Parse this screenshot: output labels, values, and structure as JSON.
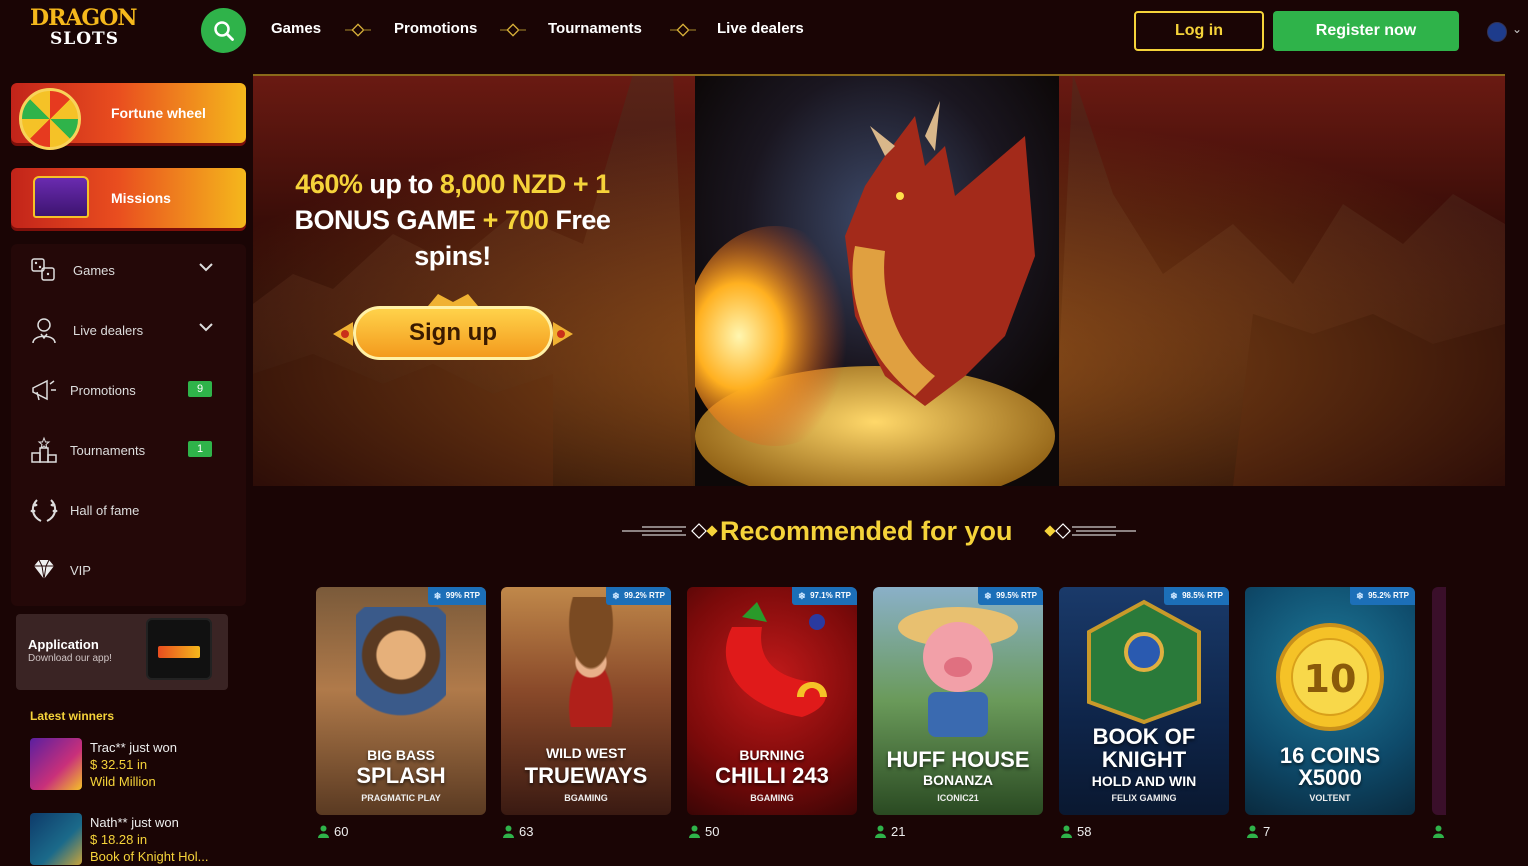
{
  "header": {
    "logo_line1": "DRAGON",
    "logo_line2": "SLOTS",
    "nav": [
      "Games",
      "Promotions",
      "Tournaments",
      "Live dealers"
    ],
    "login_label": "Log in",
    "register_label": "Register now",
    "language_icon": "nz-flag-icon"
  },
  "sidebar": {
    "fortune_wheel": "Fortune wheel",
    "missions": "Missions",
    "menu": [
      {
        "label": "Games",
        "icon": "games-icon",
        "expandable": true
      },
      {
        "label": "Live dealers",
        "icon": "dealer-icon",
        "expandable": true
      },
      {
        "label": "Promotions",
        "icon": "megaphone-icon",
        "badge": "9"
      },
      {
        "label": "Tournaments",
        "icon": "podium-icon",
        "badge": "1"
      },
      {
        "label": "Hall of fame",
        "icon": "laurel-icon"
      },
      {
        "label": "VIP",
        "icon": "diamond-icon"
      }
    ],
    "app": {
      "title": "Application",
      "subtitle": "Download our app!"
    },
    "winners_title": "Latest winners",
    "winners": [
      {
        "user": "Trac** just won",
        "amount": "$ 32.51 in",
        "game": "Wild Million"
      },
      {
        "user": "Nath** just won",
        "amount": "$ 18.28 in",
        "game": "Book of Knight Hol..."
      }
    ]
  },
  "hero": {
    "line1_a": "460%",
    "line1_b": " up to ",
    "line1_c": "8,000 NZD",
    "line1_d": " + 1",
    "line2_a": "BONUS GAME ",
    "line2_b": "+ 700",
    "line2_c": " Free",
    "line3": "spins!",
    "cta": "Sign up"
  },
  "recommended": {
    "title": "Recommended for you",
    "games": [
      {
        "top": "BIG BASS",
        "main": "SPLASH",
        "provider": "PRAGMATIC PLAY",
        "rtp": "99% RTP",
        "players": "60"
      },
      {
        "top": "WILD WEST",
        "main": "TRUEWAYS",
        "provider": "BGAMING",
        "rtp": "99.2% RTP",
        "players": "63"
      },
      {
        "top": "BURNING",
        "main": "CHILLI 243",
        "provider": "BGAMING",
        "rtp": "97.1% RTP",
        "players": "50"
      },
      {
        "top": "HUFF HOUSE",
        "main": "BONANZA",
        "provider": "ICONIC21",
        "rtp": "99.5% RTP",
        "players": "21"
      },
      {
        "top": "BOOK OF KNIGHT",
        "main": "HOLD AND WIN",
        "provider": "FELIX GAMING",
        "rtp": "98.5% RTP",
        "players": "58"
      },
      {
        "top": "16 COINS",
        "main": "X5000",
        "provider": "VOLTENT",
        "rtp": "95.2% RTP",
        "players": "7"
      }
    ]
  },
  "colors": {
    "accent_green": "#2fb34a",
    "accent_yellow": "#f5d33a",
    "background": "#1a0505"
  }
}
